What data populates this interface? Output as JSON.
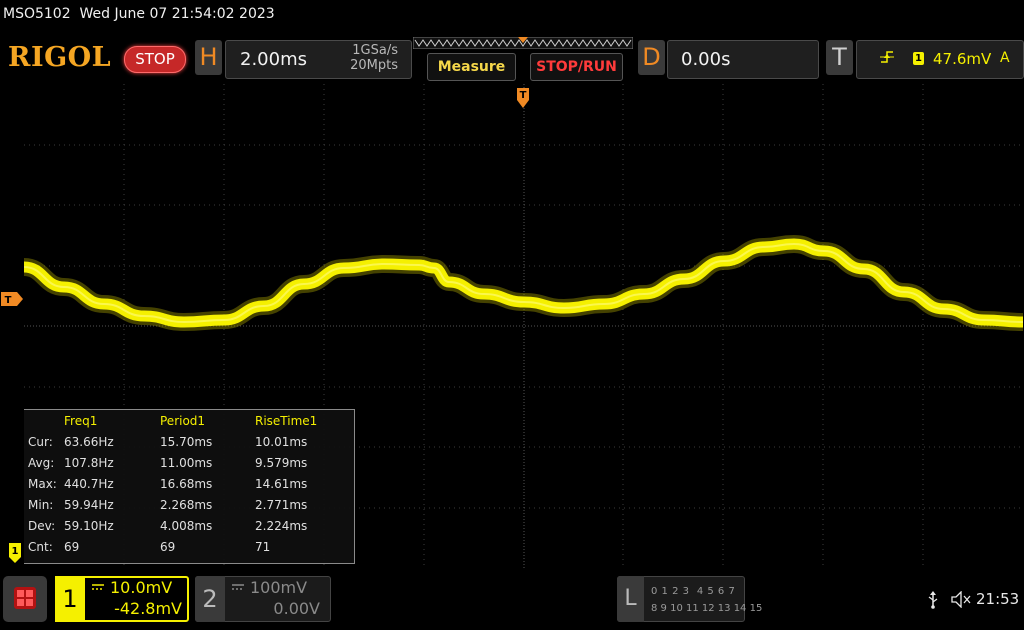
{
  "status": {
    "model": "MSO5102",
    "datetime": "Wed June 07 21:54:02 2023"
  },
  "toolbar": {
    "brand": "RIGOL",
    "run_state": "STOP",
    "horizontal": {
      "letter": "H",
      "timebase": "2.00ms",
      "sample_rate": "1GSa/s",
      "memory_depth": "20Mpts"
    },
    "measure_label": "Measure",
    "stoprun_label": "STOP/RUN",
    "delay": {
      "letter": "D",
      "value": "0.00s"
    },
    "trigger": {
      "letter": "T",
      "source": "1",
      "level": "47.6mV",
      "mode": "A"
    }
  },
  "measurements": {
    "headers": [
      "Freq1",
      "Period1",
      "RiseTime1"
    ],
    "rows": [
      {
        "label": "Cur:",
        "values": [
          "63.66Hz",
          "15.70ms",
          "10.01ms"
        ]
      },
      {
        "label": "Avg:",
        "values": [
          "107.8Hz",
          "11.00ms",
          "9.579ms"
        ]
      },
      {
        "label": "Max:",
        "values": [
          "440.7Hz",
          "16.68ms",
          "14.61ms"
        ]
      },
      {
        "label": "Min:",
        "values": [
          "59.94Hz",
          "2.268ms",
          "2.771ms"
        ]
      },
      {
        "label": "Dev:",
        "values": [
          "59.10Hz",
          "4.008ms",
          "2.224ms"
        ]
      },
      {
        "label": "Cnt:",
        "values": [
          "69",
          "69",
          "71"
        ]
      }
    ]
  },
  "channels": {
    "ch1": {
      "number": "1",
      "scale": "10.0mV",
      "offset": "-42.8mV",
      "color": "#f5f000"
    },
    "ch2": {
      "number": "2",
      "scale": "100mV",
      "offset": "0.00V",
      "color": "#8a8a8a"
    }
  },
  "markers": {
    "trigger_pos": "T",
    "channel_ground": "1"
  },
  "logic_analyzer": {
    "letter": "L",
    "row1": "0 1 2 3  4 5 6 7",
    "row2": "8 9 10 11 12 13 14 15"
  },
  "system": {
    "time": "21:53",
    "usb_icon": "usb-icon",
    "speaker_icon": "speaker-muted-icon"
  }
}
